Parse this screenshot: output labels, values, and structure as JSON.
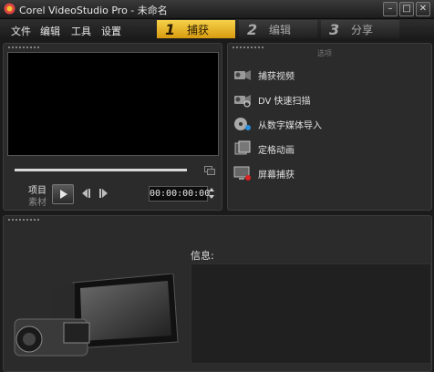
{
  "window": {
    "title": "Corel VideoStudio Pro - 未命名",
    "controls": [
      "minimize-icon",
      "maximize-icon",
      "close-icon"
    ]
  },
  "menu": {
    "items": [
      {
        "label": "文件"
      },
      {
        "label": "编辑"
      },
      {
        "label": "工具"
      },
      {
        "label": "设置"
      }
    ]
  },
  "steps": [
    {
      "number": "1",
      "label": "捕获",
      "active": true
    },
    {
      "number": "2",
      "label": "编辑",
      "active": false
    },
    {
      "number": "3",
      "label": "分享",
      "active": false
    }
  ],
  "player": {
    "project_label": "项目",
    "clip_label": "素材",
    "timecode": "00:00:00:00",
    "scrub_progress": 0
  },
  "capture": {
    "header": "选项",
    "options": [
      {
        "label": "捕获视频",
        "icon": "camcorder-icon"
      },
      {
        "label": "DV 快速扫描",
        "icon": "dv-scan-icon"
      },
      {
        "label": "从数字媒体导入",
        "icon": "disc-import-icon"
      },
      {
        "label": "定格动画",
        "icon": "stop-motion-icon"
      },
      {
        "label": "屏幕捕获",
        "icon": "screen-capture-icon"
      }
    ]
  },
  "info": {
    "label": "信息:"
  },
  "colors": {
    "accent": "#f2c230",
    "background": "#1b1b1b",
    "panel": "#2b2b2b"
  }
}
